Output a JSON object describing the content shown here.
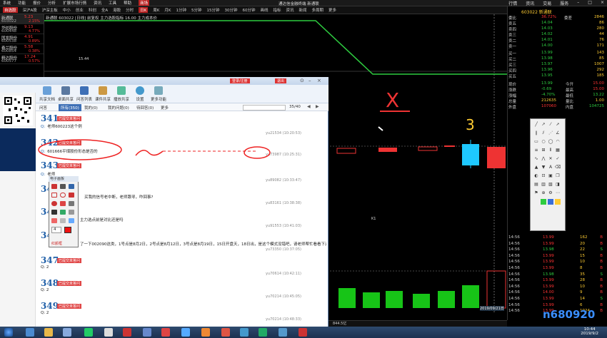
{
  "menubar": {
    "items": [
      "系统",
      "功能",
      "报价",
      "分析",
      "扩展市场行情",
      "资讯",
      "工具",
      "帮助",
      "商场"
    ],
    "title": "通达信金融终端 新通联",
    "right": [
      "行情",
      "资讯",
      "交易",
      "服务"
    ]
  },
  "toolbar2": {
    "items": [
      "自选股",
      "深沪A股",
      "沪深主板",
      "中小",
      "创业",
      "科创",
      "全A",
      "港股",
      "分时",
      "日K",
      "周K",
      "月K",
      "1分钟",
      "5分钟",
      "15分钟",
      "30分钟",
      "60分钟",
      "画线",
      "指标",
      "资讯",
      "新闻",
      "多周期",
      "更多"
    ],
    "active": "深沪A股"
  },
  "leftlist": [
    {
      "name": "新通联",
      "code": "603022",
      "price": "5.23",
      "pct": "2.15%"
    },
    {
      "name": "华纺股份",
      "code": "600448",
      "price": "9.13",
      "pct": "4.77%"
    },
    {
      "name": "国发股份",
      "code": "600538",
      "price": "4.91",
      "pct": "0.89%"
    },
    {
      "name": "春兰股份",
      "code": "600854",
      "price": "5.58",
      "pct": "0.38%"
    },
    {
      "name": "精达股份",
      "code": "600577",
      "price": "17.24",
      "pct": "0.57%"
    }
  ],
  "chart": {
    "header": "新通联 603022 [日线] 前复权 主力选股指标 16.00 主力成本价",
    "price_label": "15.44",
    "date_label": "2019/09/21日",
    "crosshair_label": "K1",
    "volume_label": "844.5亿"
  },
  "right_panel": {
    "title": "603022 新通联",
    "header_right": [
      "委比",
      "36.72%",
      "委差",
      "2846"
    ],
    "order_book": [
      {
        "label": "卖五",
        "price": "14.04",
        "vol": "86"
      },
      {
        "label": "卖四",
        "price": "14.03",
        "vol": "280"
      },
      {
        "label": "卖三",
        "price": "14.02",
        "vol": "44"
      },
      {
        "label": "卖二",
        "price": "14.01",
        "vol": "76"
      },
      {
        "label": "卖一",
        "price": "14.00",
        "vol": "171"
      },
      {
        "label": "买一",
        "price": "13.99",
        "vol": "143"
      },
      {
        "label": "买二",
        "price": "13.98",
        "vol": "85"
      },
      {
        "label": "买三",
        "price": "13.97",
        "vol": "1007"
      },
      {
        "label": "买四",
        "price": "13.96",
        "vol": "292"
      },
      {
        "label": "买五",
        "price": "13.95",
        "vol": "185"
      }
    ],
    "stats": [
      {
        "label": "现价",
        "value": "13.99",
        "label2": "今开",
        "value2": "15.00"
      },
      {
        "label": "涨跌",
        "value": "-0.69",
        "label2": "最高",
        "value2": "15.00"
      },
      {
        "label": "涨幅",
        "value": "-4.70%",
        "label2": "最低",
        "value2": "13.22"
      },
      {
        "label": "总量",
        "value": "212635",
        "label2": "量比",
        "value2": "1.00"
      },
      {
        "label": "外盘",
        "value": "107060",
        "label2": "内盘",
        "value2": "104725"
      }
    ],
    "ticks": [
      {
        "time": "14:56",
        "price": "13.99",
        "vol": "162",
        "side": "B"
      },
      {
        "time": "14:56",
        "price": "13.99",
        "vol": "20",
        "side": "B"
      },
      {
        "time": "14:56",
        "price": "13.98",
        "vol": "22",
        "side": "S"
      },
      {
        "time": "14:56",
        "price": "13.99",
        "vol": "15",
        "side": "B"
      },
      {
        "time": "14:56",
        "price": "13.99",
        "vol": "10",
        "side": "B"
      },
      {
        "time": "14:56",
        "price": "13.99",
        "vol": "8",
        "side": "B"
      },
      {
        "time": "14:56",
        "price": "13.98",
        "vol": "35",
        "side": "S"
      },
      {
        "time": "14:56",
        "price": "13.99",
        "vol": "28",
        "side": "B"
      },
      {
        "time": "14:56",
        "price": "13.99",
        "vol": "10",
        "side": "B"
      },
      {
        "time": "14:56",
        "price": "14.00",
        "vol": "9",
        "side": "B"
      },
      {
        "time": "14:56",
        "price": "13.99",
        "vol": "14",
        "side": "S"
      },
      {
        "time": "14:56",
        "price": "13.99",
        "vol": "6",
        "side": "B"
      },
      {
        "time": "14:56",
        "price": "13.99",
        "vol": "1024",
        "side": "B"
      }
    ]
  },
  "dialog": {
    "title_buttons": [
      "登录/注册",
      "退出"
    ],
    "toolbar": [
      "共享文档",
      "桌面共享",
      "问答列表",
      "课件共享",
      "播放共享",
      "设置",
      "更多功能"
    ],
    "tabs": [
      "问答",
      "所有(350)",
      "我的(0)",
      "我的问题(0)",
      "待回答(0)",
      "更多"
    ],
    "page": "35/40",
    "questions": [
      {
        "num": "341",
        "tag": "已提交未答问",
        "text": "老师600223这个例",
        "meta": "yu21534 (10:20:53)"
      },
      {
        "num": "342",
        "tag": "已提交未答问",
        "text": "601666平煤股份形态是否的",
        "meta": "yu73987 (10:25:31)"
      },
      {
        "num": "343",
        "tag": "已提交未答问",
        "text": "老师",
        "meta": "yu89082 (10:33:47)"
      },
      {
        "num": "344",
        "tag": "已提交未答问",
        "text": "买我的信号老中断，老师跟寻，咋回事?",
        "meta": "yu83161 (10:38:38)"
      },
      {
        "num": "345",
        "tag": "已提交未答问",
        "text": "主力选点前是对比还是吗",
        "meta": "yu91553 (10:41:03)"
      },
      {
        "num": "346",
        "tag": "已提交未答问",
        "text": "了一下002090这类，1号点是8月2日，2号点是8月12日，3号点是8月19日，15日开盘天，18日出，是这个模式没错吧，请老师帮忙看看下过了",
        "meta": "yu73350 (10:37:05)"
      },
      {
        "num": "347",
        "tag": "已提交未答问",
        "text": "Q: 2",
        "meta": "yu70614 (10:42:11)"
      },
      {
        "num": "348",
        "tag": "已提交未答问",
        "text": "Q: 2",
        "meta": "yu70214 (10:45:05)"
      },
      {
        "num": "349",
        "tag": "已提交未答问",
        "text": "Q: 2",
        "meta": "yu70214 (10:48:33)"
      }
    ],
    "annotation_big": "3",
    "annotation_x": "X"
  },
  "palette": {
    "title": "电子画板",
    "size": "4",
    "label": "红颜框"
  },
  "taskbar": {
    "time": "10:44",
    "date": "2019/9/2"
  },
  "watermark": "n680920"
}
